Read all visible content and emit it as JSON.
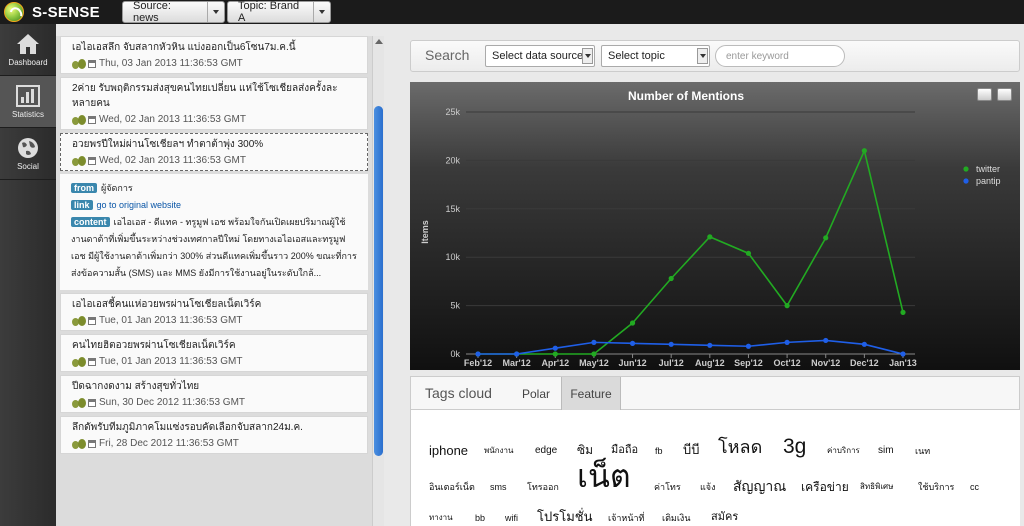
{
  "app": {
    "name": "S-SENSE"
  },
  "header": {
    "source_label": "Source: news",
    "topic_label": "Topic: Brand A"
  },
  "nav": [
    {
      "label": "Dashboard",
      "icon": "home-icon"
    },
    {
      "label": "Statistics",
      "icon": "bar-chart-icon"
    },
    {
      "label": "Social",
      "icon": "globe-icon"
    }
  ],
  "news": [
    {
      "title": "เอไอเอสลึก จับสลากหัวหิน แบ่งออกเป็น6โซน7ม.ค.นี้",
      "date": "Thu, 03 Jan 2013 11:36:53 GMT"
    },
    {
      "title": "2ค่าย รับพฤติกรรมส่งสุขคนไทยเปลี่ยน แห่ใช้โซเชียลส่งครั้งละหลายคน",
      "date": "Wed, 02 Jan 2013 11:36:53 GMT"
    },
    {
      "title": "อวยพรปีใหม่ผ่านโซเชียลฯ ทำตาต้าพุ่ง 300%",
      "date": "Wed, 02 Jan 2013 11:36:53 GMT"
    },
    {
      "title": "เอไอเอสชี้คนแห่อวยพรผ่านโซเชียลเน็ตเวิร์ค",
      "date": "Tue, 01 Jan 2013 11:36:53 GMT"
    },
    {
      "title": "คนไทยฮิตอวยพรผ่านโซเชียลเน็ตเวิร์ค",
      "date": "Tue, 01 Jan 2013 11:36:53 GMT"
    },
    {
      "title": "ปีดฉากงดงาม สร้างสุขทั่วไทย",
      "date": "Sun, 30 Dec 2012 11:36:53 GMT"
    },
    {
      "title": "ลึกดัพรับทีมภูมิภาคโมแซ่งรอบคัดเลือกจับสลาก24ม.ค.",
      "date": "Fri, 28 Dec 2012 11:36:53 GMT"
    }
  ],
  "detail": {
    "from_label": "from",
    "from_value": "ผู้จัดการ",
    "link_label": "link",
    "link_value": "go to original website",
    "content_label": "content",
    "content_value": "เอไอเอส - ดีแทค - ทรูมูฟ เอช พร้อมใจกันเปิดเผยปริมาณผู้ใช้งานดาต้าที่เพิ่มขึ้นระหว่างช่วงเทศกาลปีใหม่ โดยทางเอไอเอสและทรูมูฟ เอช มีผู้ใช้งานดาต้าเพิ่มกว่า 300% ส่วนดีแทคเพิ่มขึ้นราว 200% ขณะที่การส่งข้อความสั้น (SMS) และ MMS ยังมีการใช้งานอยู่ในระดับใกล้..."
  },
  "search": {
    "label": "Search",
    "source_select": "Select data source",
    "topic_select": "Select topic",
    "keyword_placeholder": "enter keyword"
  },
  "chart_data": {
    "type": "line",
    "title": "Number of Mentions",
    "ylabel": "Items",
    "categories": [
      "Feb'12",
      "Mar'12",
      "Apr'12",
      "May'12",
      "Jun'12",
      "Jul'12",
      "Aug'12",
      "Sep'12",
      "Oct'12",
      "Nov'12",
      "Dec'12",
      "Jan'13"
    ],
    "y_ticks": [
      "0k",
      "5k",
      "10k",
      "15k",
      "20k",
      "25k"
    ],
    "ylim": [
      0,
      25000
    ],
    "legend_position": "right",
    "series": [
      {
        "name": "twitter",
        "color": "#22aa22",
        "values": [
          0,
          0,
          0,
          0,
          3200,
          7800,
          12100,
          10400,
          5000,
          12000,
          21000,
          4300
        ]
      },
      {
        "name": "pantip",
        "color": "#1f5fe8",
        "values": [
          0,
          0,
          600,
          1200,
          1100,
          1000,
          900,
          800,
          1200,
          1400,
          1000,
          0
        ]
      }
    ]
  },
  "tags": {
    "title": "Tags cloud",
    "tabs": [
      "Polar",
      "Feature"
    ],
    "active_tab": "Feature",
    "words": [
      "iphone",
      "พนักงาน",
      "edge",
      "ซิม",
      "มือถือ",
      "fb",
      "บีบี",
      "โหลด",
      "3g",
      "ค่าบริการ",
      "sim",
      "เนท",
      "อินเตอร์เน็ต",
      "sms",
      "โทรออก",
      "เน็ต",
      "ค่าโทร",
      "แจ้ง",
      "สัญญาณ",
      "เครือข่าย",
      "สิทธิพิเศษ",
      "ใช้บริการ",
      "cc",
      "ทางาน",
      "bb",
      "wifi",
      "โปรโมชั่น",
      "เจ้าหน้าที่",
      "เติมเงิน",
      "สมัคร"
    ]
  }
}
